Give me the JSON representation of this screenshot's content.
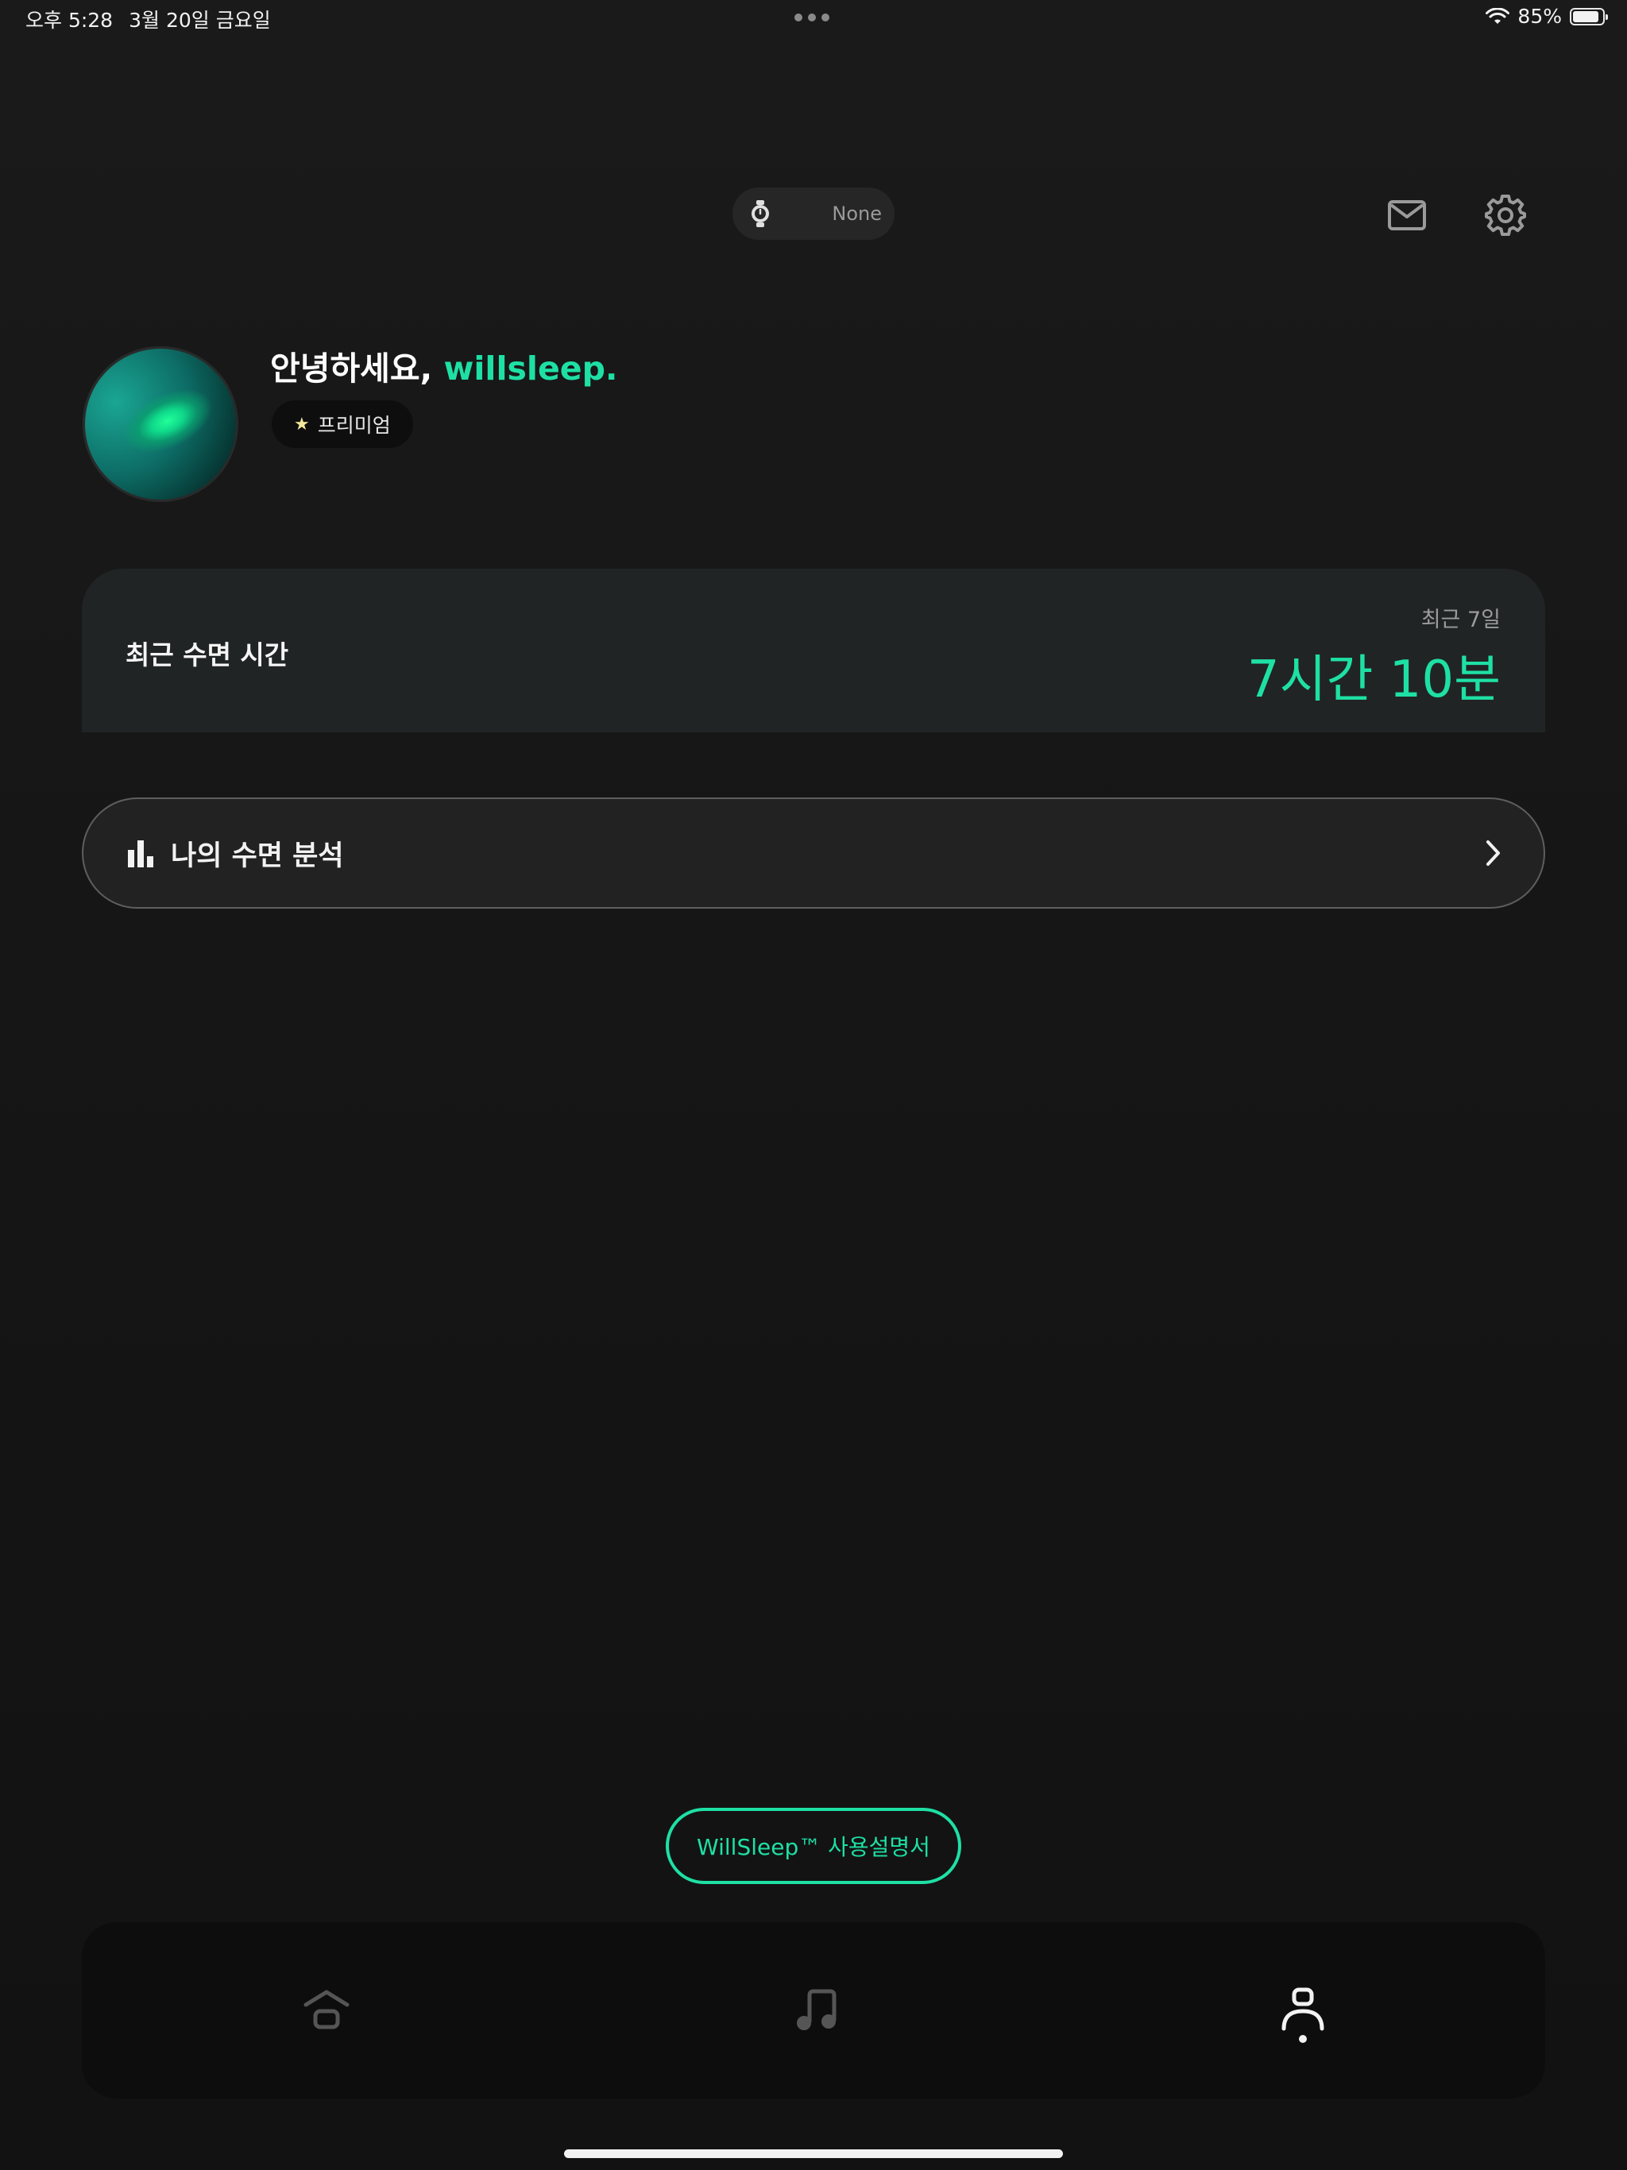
{
  "status_bar": {
    "time": "오후 5:28",
    "date": "3월 20일 금요일",
    "battery": "85%"
  },
  "header": {
    "device_label": "None",
    "icons": [
      "watch-icon",
      "mail-icon",
      "gear-icon"
    ]
  },
  "profile": {
    "greeting": "안녕하세요, ",
    "username": "willsleep.",
    "badge": "프리미엄"
  },
  "sleep_card": {
    "title": "최근 수면 시간",
    "period": "최근 7일",
    "value": "7시간 10분"
  },
  "analysis": {
    "label": "나의 수면 분석"
  },
  "manual_button": "WillSleep™ 사용설명서",
  "tabbar": {
    "tabs": [
      "home",
      "music",
      "profile"
    ],
    "active": "profile"
  },
  "colors": {
    "accent": "#1ee0a4",
    "background": "#161616",
    "card": "#212424"
  }
}
